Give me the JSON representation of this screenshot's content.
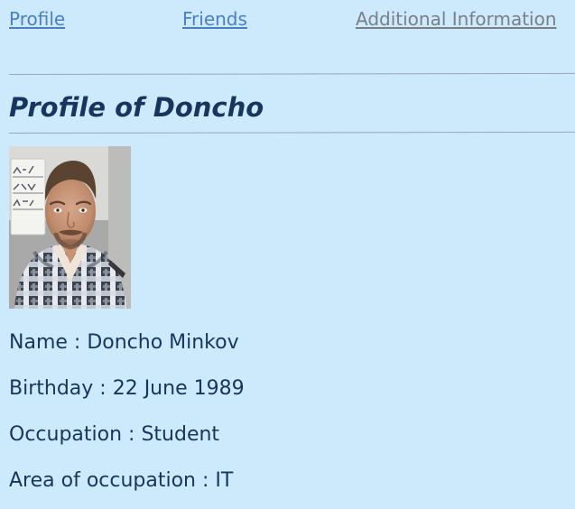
{
  "nav": {
    "profile": "Profile",
    "friends": "Friends",
    "additional": "Additional Information"
  },
  "profile": {
    "title": "Profile of Doncho",
    "fields": [
      {
        "label": "Name",
        "separator": " : ",
        "value": "Doncho Minkov"
      },
      {
        "label": "Birthday",
        "separator": " : ",
        "value": "22 June 1989"
      },
      {
        "label": "Occupation",
        "separator": " : ",
        "value": "Student"
      },
      {
        "label": "Area of occupation",
        "separator": " : ",
        "value": "IT"
      }
    ]
  },
  "colors": {
    "background": "#cdeafd",
    "link": "#4a7fc4",
    "link_muted": "#7a7f86",
    "text": "#17365d"
  }
}
